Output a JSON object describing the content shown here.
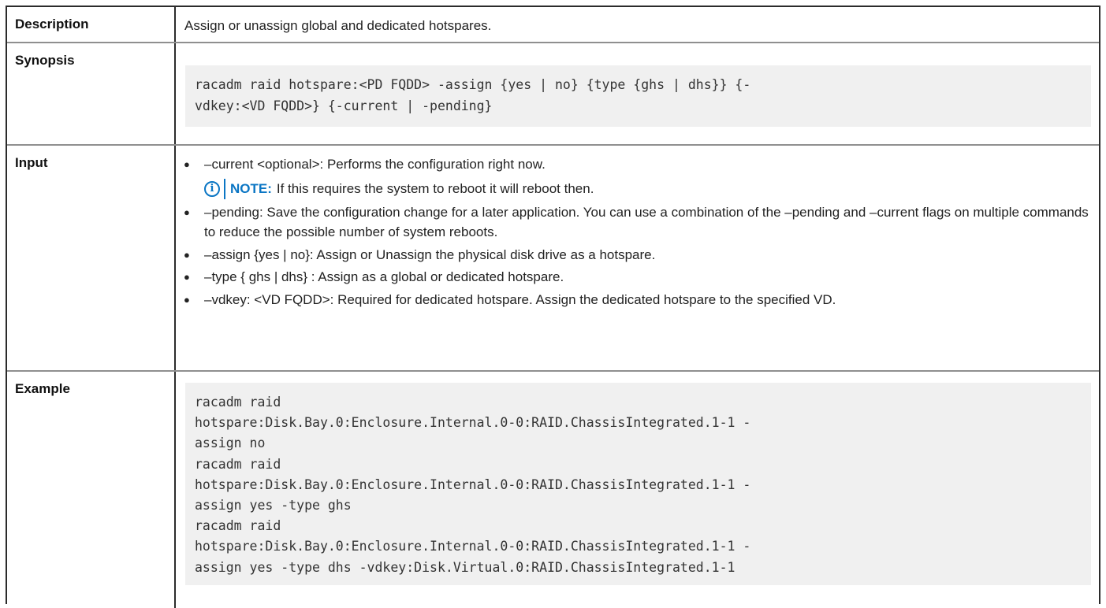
{
  "rows": {
    "description": {
      "label": "Description",
      "text": "Assign or unassign global and dedicated hotspares."
    },
    "synopsis": {
      "label": "Synopsis",
      "code": "racadm raid hotspare:<PD FQDD> -assign {yes | no} {type {ghs | dhs}} {-\nvdkey:<VD FQDD>} {-current | -pending}"
    },
    "input": {
      "label": "Input",
      "items": [
        {
          "text": "–current <optional>: Performs the configuration right now.",
          "note": {
            "icon": "info-icon",
            "label": "NOTE:",
            "text": "If this requires the system to reboot it will reboot then."
          }
        },
        {
          "text": "–pending: Save the configuration change for a later application. You can use a combination of the –pending and –current flags on multiple commands to reduce the possible number of system reboots."
        },
        {
          "text": "–assign {yes | no}: Assign or Unassign the physical disk drive as a hotspare."
        },
        {
          "text": "–type { ghs | dhs} : Assign as a global or dedicated hotspare."
        },
        {
          "text": "–vdkey: <VD FQDD>: Required for dedicated hotspare. Assign the dedicated hotspare to the specified VD."
        }
      ]
    },
    "example": {
      "label": "Example",
      "code": "racadm raid\nhotspare:Disk.Bay.0:Enclosure.Internal.0-0:RAID.ChassisIntegrated.1-1 -\nassign no\nracadm raid\nhotspare:Disk.Bay.0:Enclosure.Internal.0-0:RAID.ChassisIntegrated.1-1 -\nassign yes -type ghs\nracadm raid\nhotspare:Disk.Bay.0:Enclosure.Internal.0-0:RAID.ChassisIntegrated.1-1 -\nassign yes -type dhs -vdkey:Disk.Virtual.0:RAID.ChassisIntegrated.1-1"
    }
  },
  "colors": {
    "note_accent": "#0b76c4",
    "code_background": "#f0f0f0"
  }
}
